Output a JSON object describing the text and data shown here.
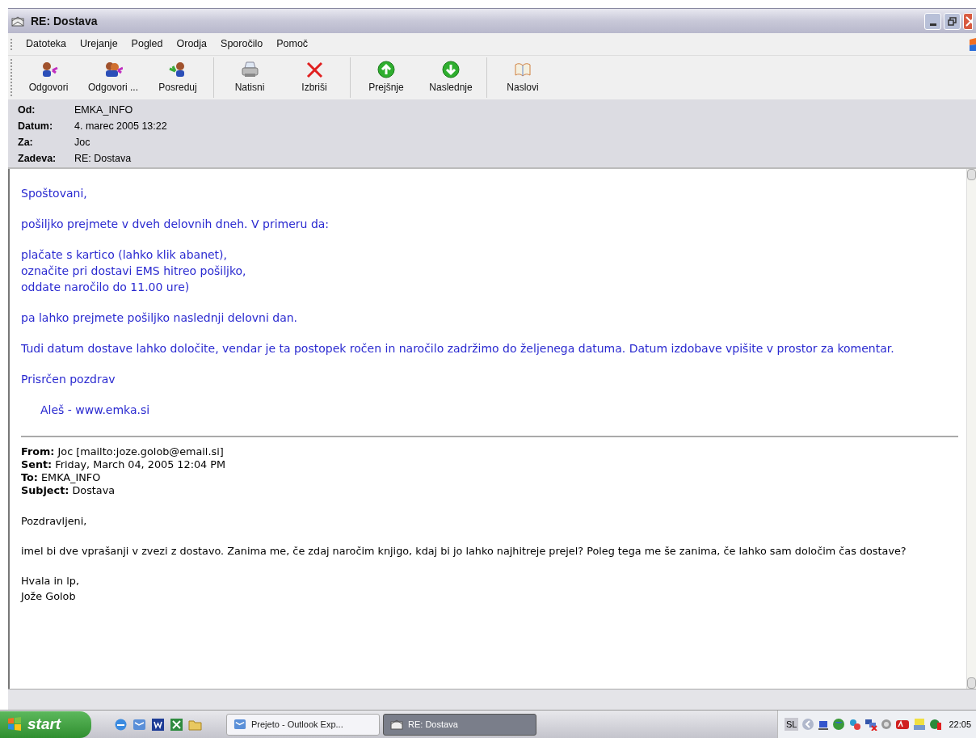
{
  "window": {
    "title": "RE: Dostava"
  },
  "menu": [
    "Datoteka",
    "Urejanje",
    "Pogled",
    "Orodja",
    "Sporočilo",
    "Pomoč"
  ],
  "toolbar": [
    [
      {
        "label": "Odgovori",
        "kind": "reply"
      },
      {
        "label": "Odgovori ...",
        "kind": "reply-all"
      },
      {
        "label": "Posreduj",
        "kind": "forward"
      }
    ],
    [
      {
        "label": "Natisni",
        "kind": "print"
      },
      {
        "label": "Izbriši",
        "kind": "delete"
      }
    ],
    [
      {
        "label": "Prejšnje",
        "kind": "up"
      },
      {
        "label": "Naslednje",
        "kind": "down"
      }
    ],
    [
      {
        "label": "Naslovi",
        "kind": "book"
      }
    ]
  ],
  "header": [
    {
      "label": "Od:",
      "value": "EMKA_INFO"
    },
    {
      "label": "Datum:",
      "value": "4. marec 2005 13:22"
    },
    {
      "label": "Za:",
      "value": "Joc"
    },
    {
      "label": "Zadeva:",
      "value": "RE: Dostava"
    }
  ],
  "reply": [
    {
      "lines": [
        "Spoštovani,"
      ]
    },
    {
      "lines": [
        "pošiljko prejmete v dveh delovnih dneh. V primeru da:"
      ]
    },
    {
      "lines": [
        "plačate s kartico (lahko klik abanet),",
        "označite pri dostavi EMS hitreo pošiljko,",
        "oddate naročilo do 11.00 ure)"
      ]
    },
    {
      "lines": [
        "pa lahko prejmete pošiljko naslednji delovni dan."
      ]
    },
    {
      "lines": [
        "Tudi datum dostave lahko določite, vendar je ta postopek ročen in naročilo zadržimo do željenega datuma. Datum izdobave vpišite v prostor za komentar."
      ]
    },
    {
      "lines": [
        "Prisrčen pozdrav"
      ]
    }
  ],
  "signature": "Aleš - www.emka.si",
  "quoted_header": [
    {
      "label": "From:",
      "value": "Joc [mailto:joze.golob@email.si]"
    },
    {
      "label": "Sent:",
      "value": "Friday, March 04, 2005 12:04 PM"
    },
    {
      "label": "To:",
      "value": "EMKA_INFO"
    },
    {
      "label": "Subject:",
      "value": "Dostava"
    }
  ],
  "quoted": [
    {
      "lines": [
        "Pozdravljeni,"
      ]
    },
    {
      "lines": [
        "imel bi dve vprašanji v zvezi z dostavo. Zanima me, če zdaj naročim knjigo, kdaj bi jo lahko najhitreje prejel? Poleg tega me še zanima, če lahko sam določim čas dostave?"
      ]
    },
    {
      "lines": [
        "Hvala in lp,",
        "Jože Golob"
      ]
    }
  ],
  "taskbar": {
    "start": "start",
    "tasks": [
      {
        "label": "Prejeto - Outlook Exp...",
        "selected": false
      },
      {
        "label": "RE: Dostava",
        "selected": true
      }
    ],
    "language": "SL",
    "time": "22:05"
  }
}
